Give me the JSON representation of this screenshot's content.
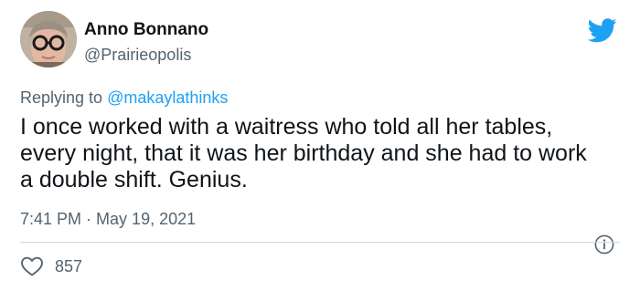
{
  "author": {
    "display_name": "Anno Bonnano",
    "handle": "@Prairieopolis"
  },
  "reply": {
    "prefix": "Replying to ",
    "mention": "@makaylathinks"
  },
  "tweet": {
    "text": "I once worked with a waitress who told all her tables, every night, that it was her birthday and she had to work a double shift. Genius.",
    "time": "7:41 PM",
    "separator": " · ",
    "date": "May 19, 2021"
  },
  "engagement": {
    "likes": "857"
  },
  "icons": {
    "brand": "twitter-bird-icon",
    "info": "info-icon",
    "like": "heart-icon"
  },
  "colors": {
    "brand_blue": "#1da1f2",
    "text_primary": "#0f1419",
    "text_secondary": "#536471",
    "divider": "#cfd9de"
  }
}
